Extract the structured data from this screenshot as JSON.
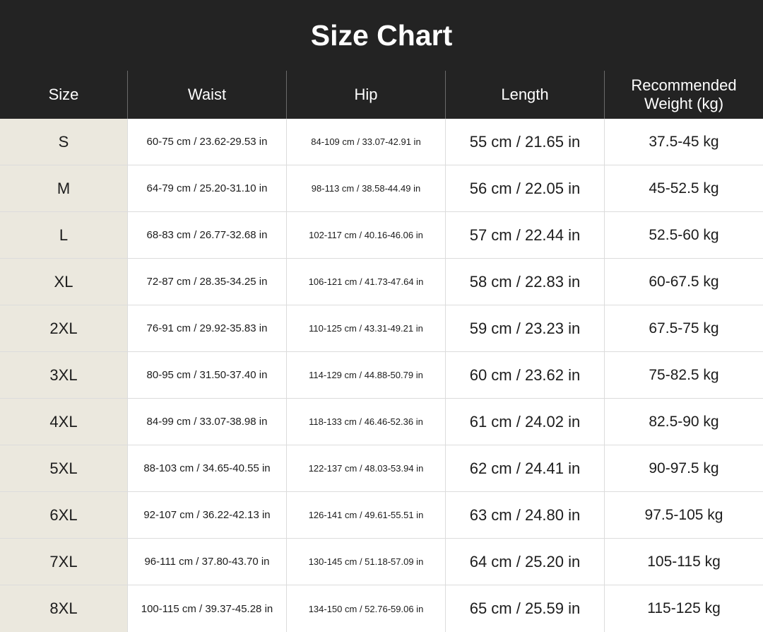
{
  "title": "Size Chart",
  "columns": [
    "Size",
    "Waist",
    "Hip",
    "Length",
    "Recommended\nWeight (kg)"
  ],
  "colors": {
    "header_bg": "#232323",
    "header_text": "#ffffff",
    "size_column_bg": "#ebe8de",
    "grid_line": "#dcdcdc",
    "body_text": "#1c1c1c"
  },
  "rows": [
    {
      "size": "S",
      "waist": "60-75 cm / 23.62-29.53 in",
      "hip": "84-109 cm / 33.07-42.91 in",
      "length": "55 cm / 21.65 in",
      "weight": "37.5-45 kg"
    },
    {
      "size": "M",
      "waist": "64-79 cm / 25.20-31.10 in",
      "hip": "98-113 cm / 38.58-44.49 in",
      "length": "56 cm / 22.05 in",
      "weight": "45-52.5 kg"
    },
    {
      "size": "L",
      "waist": "68-83 cm / 26.77-32.68 in",
      "hip": "102-117 cm / 40.16-46.06 in",
      "length": "57 cm / 22.44 in",
      "weight": "52.5-60 kg"
    },
    {
      "size": "XL",
      "waist": "72-87 cm / 28.35-34.25 in",
      "hip": "106-121 cm / 41.73-47.64 in",
      "length": "58 cm / 22.83 in",
      "weight": "60-67.5 kg"
    },
    {
      "size": "2XL",
      "waist": "76-91 cm / 29.92-35.83 in",
      "hip": "110-125 cm / 43.31-49.21 in",
      "length": "59 cm / 23.23 in",
      "weight": "67.5-75 kg"
    },
    {
      "size": "3XL",
      "waist": "80-95 cm / 31.50-37.40 in",
      "hip": "114-129 cm / 44.88-50.79 in",
      "length": "60 cm / 23.62 in",
      "weight": "75-82.5 kg"
    },
    {
      "size": "4XL",
      "waist": "84-99 cm / 33.07-38.98 in",
      "hip": "118-133 cm / 46.46-52.36 in",
      "length": "61 cm / 24.02 in",
      "weight": "82.5-90 kg"
    },
    {
      "size": "5XL",
      "waist": "88-103 cm / 34.65-40.55 in",
      "hip": "122-137 cm / 48.03-53.94 in",
      "length": "62 cm / 24.41 in",
      "weight": "90-97.5 kg"
    },
    {
      "size": "6XL",
      "waist": "92-107 cm / 36.22-42.13 in",
      "hip": "126-141 cm / 49.61-55.51 in",
      "length": "63 cm / 24.80 in",
      "weight": "97.5-105 kg"
    },
    {
      "size": "7XL",
      "waist": "96-111 cm / 37.80-43.70 in",
      "hip": "130-145 cm / 51.18-57.09 in",
      "length": "64 cm / 25.20 in",
      "weight": "105-115 kg"
    },
    {
      "size": "8XL",
      "waist": "100-115 cm / 39.37-45.28 in",
      "hip": "134-150 cm / 52.76-59.06 in",
      "length": "65 cm / 25.59 in",
      "weight": "115-125 kg"
    }
  ]
}
